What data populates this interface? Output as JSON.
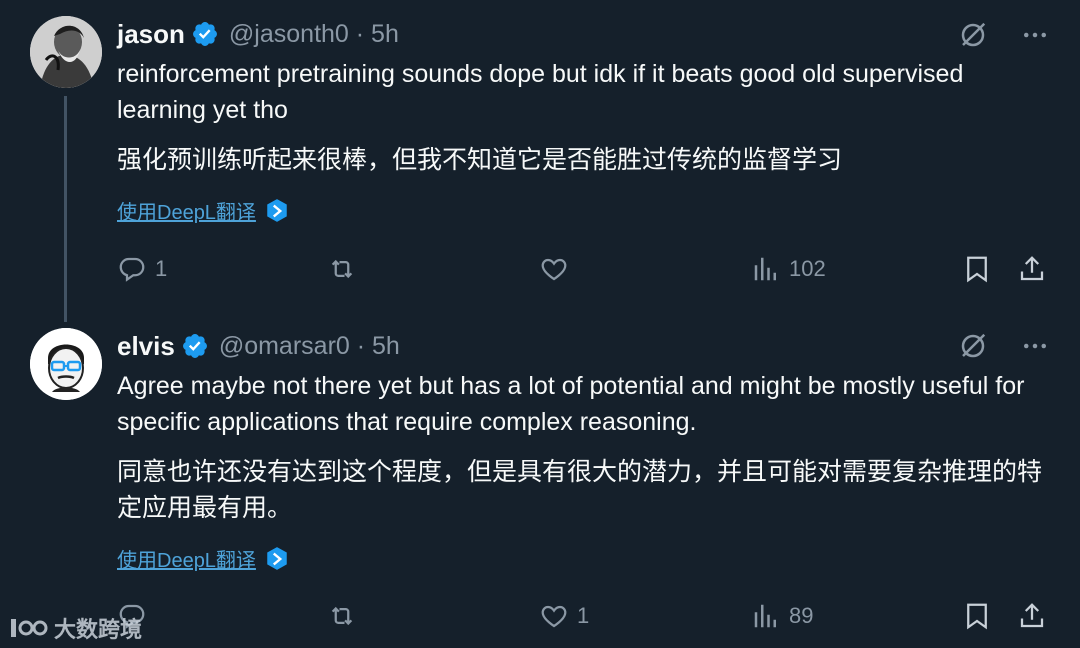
{
  "tweets": [
    {
      "name": "jason",
      "handle": "@jasonth0 · 5h",
      "text_en": "reinforcement pretraining sounds dope but idk if it beats good old supervised learning yet tho",
      "text_zh": "强化预训练听起来很棒，但我不知道它是否能胜过传统的监督学习",
      "translate_label": "使用DeepL翻译",
      "replies": "1",
      "retweets": "",
      "likes": "",
      "views": "102"
    },
    {
      "name": "elvis",
      "handle": "@omarsar0 · 5h",
      "text_en": "Agree maybe not there yet but has a lot of potential and might be mostly useful for specific applications that require complex reasoning.",
      "text_zh": "同意也许还没有达到这个程度，但是具有很大的潜力，并且可能对需要复杂推理的特定应用最有用。",
      "translate_label": "使用DeepL翻译",
      "replies": "",
      "retweets": "",
      "likes": "1",
      "views": "89"
    }
  ],
  "watermark": "大数跨境",
  "colors": {
    "background": "#15202b",
    "text": "#f7f9f9",
    "muted": "#8b98a5",
    "accent": "#1d9bf0"
  },
  "icons": [
    "verified-badge-icon",
    "grok-icon",
    "more-icon",
    "reply-icon",
    "retweet-icon",
    "like-icon",
    "views-icon",
    "bookmark-icon",
    "share-icon",
    "deepl-icon"
  ]
}
